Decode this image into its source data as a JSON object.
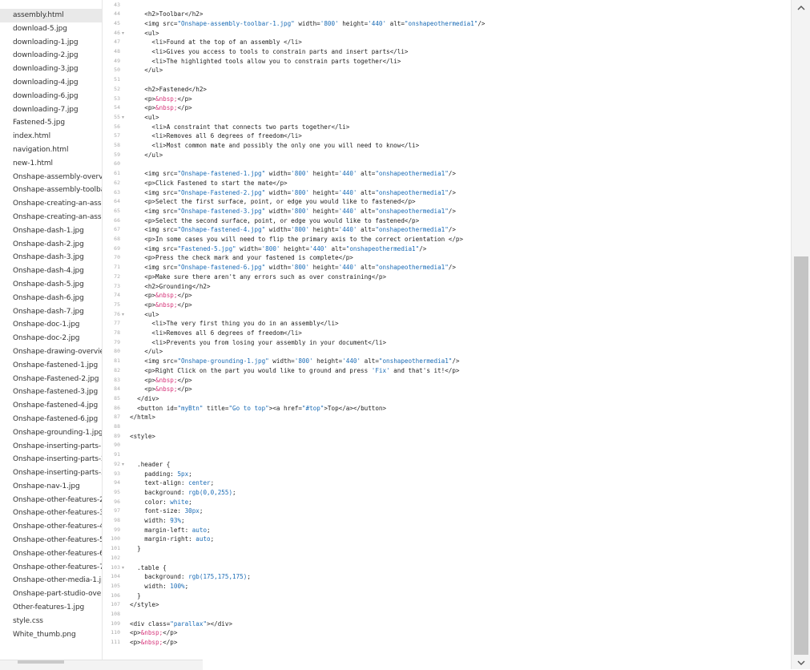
{
  "files": [
    "assembly.html",
    "download-5.jpg",
    "downloading-1.jpg",
    "downloading-2.jpg",
    "downloading-3.jpg",
    "downloading-4.jpg",
    "downloading-6.jpg",
    "downloading-7.jpg",
    "Fastened-5.jpg",
    "index.html",
    "navigation.html",
    "new-1.html",
    "Onshape-assembly-overv",
    "Onshape-assembly-toolba",
    "Onshape-creating-an-asse",
    "Onshape-creating-an-asse",
    "Onshape-dash-1.jpg",
    "Onshape-dash-2.jpg",
    "Onshape-dash-3.jpg",
    "Onshape-dash-4.jpg",
    "Onshape-dash-5.jpg",
    "Onshape-dash-6.jpg",
    "Onshape-dash-7.jpg",
    "Onshape-doc-1.jpg",
    "Onshape-doc-2.jpg",
    "Onshape-drawing-overview",
    "Onshape-fastened-1.jpg",
    "Onshape-Fastened-2.jpg",
    "Onshape-fastened-3.jpg",
    "Onshape-fastened-4.jpg",
    "Onshape-fastened-6.jpg",
    "Onshape-grounding-1.jpg",
    "Onshape-inserting-parts-1.",
    "Onshape-inserting-parts-2.",
    "Onshape-inserting-parts-3.",
    "Onshape-nav-1.jpg",
    "Onshape-other-features-2.",
    "Onshape-other-features-3.",
    "Onshape-other-features-4.",
    "Onshape-other-features-5.",
    "Onshape-other-features-6.",
    "Onshape-other-features-7.",
    "Onshape-other-media-1.jp",
    "Onshape-part-studio-overv",
    "Other-features-1.jpg",
    "style.css",
    "White_thumb.png"
  ],
  "active_file": "assembly.html",
  "first_line_number": 43,
  "fold_lines": [
    46,
    55,
    76,
    92,
    103
  ],
  "code_lines": [
    "",
    "    <h2>Toolbar</h2>",
    "    <img src=\"Onshape-assembly-toolbar-1.jpg\" width='800' height='440' alt=\"onshapeothermedia1\"/>",
    "    <ul>",
    "      <li>Found at the top of an assembly </li>",
    "      <li>Gives you access to tools to constrain parts and insert parts</li>",
    "      <li>The highlighted tools allow you to constrain parts together</li>",
    "    </ul>",
    "",
    "    <h2>Fastened</h2>",
    "    <p>&nbsp;</p>",
    "    <p>&nbsp;</p>",
    "    <ul>",
    "      <li>A constraint that connects two parts together</li>",
    "      <li>Removes all 6 degrees of freedom</li>",
    "      <li>Most common mate and possibly the only one you will need to know</li>",
    "    </ul>",
    "",
    "    <img src=\"Onshape-fastened-1.jpg\" width='800' height='440' alt=\"onshapeothermedia1\"/>",
    "    <p>Click Fastened to start the mate</p>",
    "    <img src=\"Onshape-Fastened-2.jpg\" width='800' height='440' alt=\"onshapeothermedia1\"/>",
    "    <p>Select the first surface, point, or edge you would like to fastened</p>",
    "    <img src=\"Onshape-fastened-3.jpg\" width='800' height='440' alt=\"onshapeothermedia1\"/>",
    "    <p>Select the second surface, point, or edge you would like to fastened</p>",
    "    <img src=\"Onshape-fastened-4.jpg\" width='800' height='440' alt=\"onshapeothermedia1\"/>",
    "    <p>In some cases you will need to flip the primary axis to the correct orientation </p>",
    "    <img src=\"Fastened-5.jpg\" width='800' height='440' alt=\"onshapeothermedia1\"/>",
    "    <p>Press the check mark and your fastened is complete</p>",
    "    <img src=\"Onshape-fastened-6.jpg\" width='800' height='440' alt=\"onshapeothermedia1\"/>",
    "    <p>Make sure there aren't any errors such as over constraining</p>",
    "    <h2>Grounding</h2>",
    "    <p>&nbsp;</p>",
    "    <p>&nbsp;</p>",
    "    <ul>",
    "      <li>The very first thing you do in an assembly</li>",
    "      <li>Removes all 6 degrees of freedom</li>",
    "      <li>Prevents you from losing your assembly in your document</li>",
    "    </ul>",
    "    <img src=\"Onshape-grounding-1.jpg\" width='800' height='440' alt=\"onshapeothermedia1\"/>",
    "    <p>Right Click on the part you would like to ground and press 'Fix' and that's it!</p>",
    "    <p>&nbsp;</p>",
    "    <p>&nbsp;</p>",
    "  </div>",
    "  <button id=\"myBtn\" title=\"Go to top\"><a href=\"#top\">Top</a></button>",
    "</html>",
    "",
    "<style>",
    "",
    "",
    "  .header {",
    "    padding: 5px;",
    "    text-align: center;",
    "    background: rgb(0,0,255);",
    "    color: white;",
    "    font-size: 30px;",
    "    width: 93%;",
    "    margin-left: auto;",
    "    margin-right: auto;",
    "  }",
    "",
    "  .table {",
    "    background: rgb(175,175,175);",
    "    width: 100%;",
    "  }",
    "</style>",
    "",
    "<div class=\"parallax\"></div>",
    "<p>&nbsp;</p>",
    "<p>&nbsp;</p>"
  ],
  "colors": {
    "string": "#1a6bb5",
    "entity": "#d6357a",
    "text": "#1f1f1f",
    "line_number": "#aaaaaa"
  },
  "icons": {
    "scroll_up": "chevron-up-icon",
    "scroll_down": "chevron-down-icon"
  }
}
